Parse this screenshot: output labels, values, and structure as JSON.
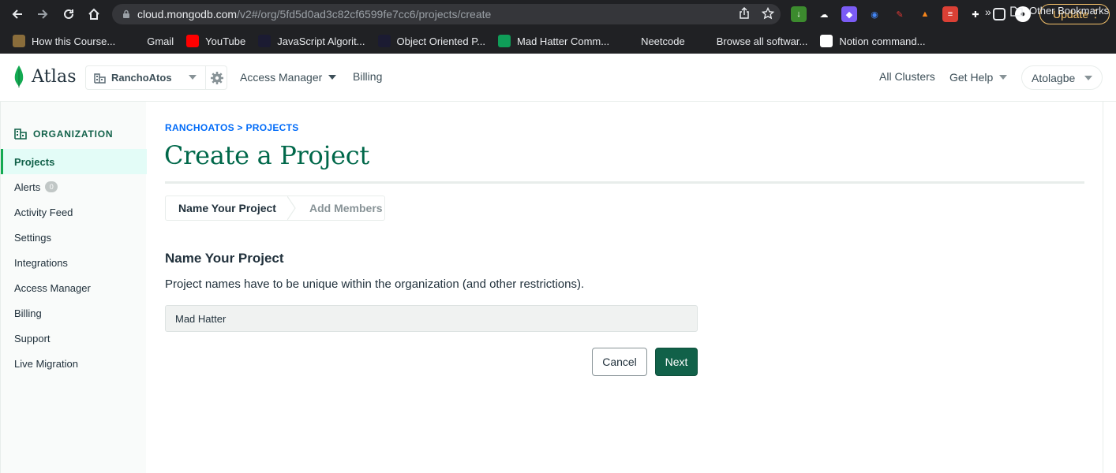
{
  "browser": {
    "url_host": "cloud.mongodb.com",
    "url_path": "/v2#/org/5fd5d0ad3c82cf6599fe7cc6/projects/create",
    "update_label": "Update",
    "bookmarks": [
      {
        "label": "How this Course...",
        "icon": "person-icon",
        "color": "#8a6d3b"
      },
      {
        "label": "Gmail",
        "icon": "gmail-icon",
        "color": "#202124"
      },
      {
        "label": "YouTube",
        "icon": "youtube-icon",
        "color": "#ff0000"
      },
      {
        "label": "JavaScript Algorit...",
        "icon": "fcc-icon",
        "color": "#1b1b32"
      },
      {
        "label": "Object Oriented P...",
        "icon": "fcc-icon",
        "color": "#1b1b32"
      },
      {
        "label": "Mad Hatter Comm...",
        "icon": "sheets-icon",
        "color": "#0f9d58"
      },
      {
        "label": "Neetcode",
        "icon": "neetcode-icon",
        "color": "#202124"
      },
      {
        "label": "Browse all softwar...",
        "icon": "chart-icon",
        "color": "#202124"
      },
      {
        "label": "Notion command...",
        "icon": "google-icon",
        "color": "#ffffff"
      }
    ],
    "more_label": "»",
    "other_bookmarks_label": "Other Bookmarks"
  },
  "header": {
    "logo_text": "Atlas",
    "org_name": "RanchoAtos",
    "nav": {
      "access_manager": "Access Manager",
      "billing": "Billing",
      "all_clusters": "All Clusters",
      "get_help": "Get Help"
    },
    "user": "Atolagbe"
  },
  "sidebar": {
    "heading": "ORGANIZATION",
    "items": [
      {
        "label": "Projects",
        "active": true
      },
      {
        "label": "Alerts",
        "badge": "0"
      },
      {
        "label": "Activity Feed"
      },
      {
        "label": "Settings"
      },
      {
        "label": "Integrations"
      },
      {
        "label": "Access Manager"
      },
      {
        "label": "Billing"
      },
      {
        "label": "Support"
      },
      {
        "label": "Live Migration"
      }
    ]
  },
  "main": {
    "breadcrumb": "RANCHOATOS > PROJECTS",
    "title": "Create a Project",
    "steps": [
      "Name Your Project",
      "Add Members"
    ],
    "section_title": "Name Your Project",
    "section_desc": "Project names have to be unique within the organization (and other restrictions).",
    "project_name_value": "Mad Hatter",
    "cancel_label": "Cancel",
    "next_label": "Next"
  },
  "colors": {
    "brand_green": "#116149",
    "link_blue": "#016bf8",
    "title_green": "#00684a"
  }
}
